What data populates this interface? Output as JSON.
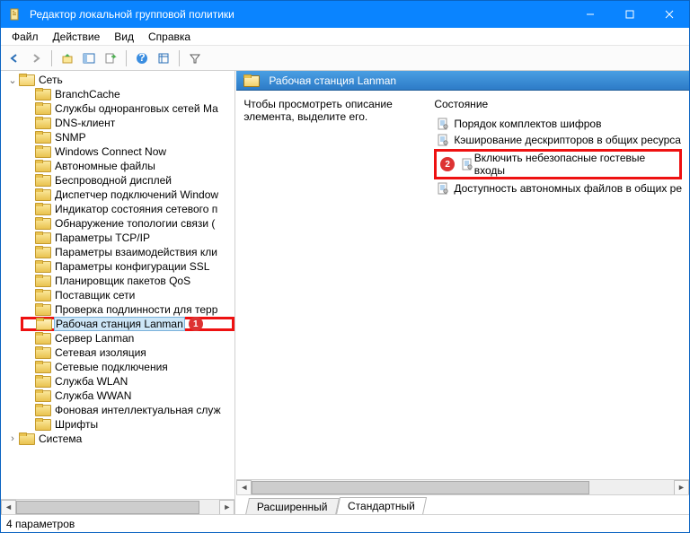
{
  "window": {
    "title": "Редактор локальной групповой политики"
  },
  "menu": {
    "file": "Файл",
    "action": "Действие",
    "view": "Вид",
    "help": "Справка"
  },
  "tree": {
    "root": "Сеть",
    "items": [
      "BranchCache",
      "Службы одноранговых сетей Ма",
      "DNS-клиент",
      "SNMP",
      "Windows Connect Now",
      "Автономные файлы",
      "Беспроводной дисплей",
      "Диспетчер подключений Window",
      "Индикатор состояния сетевого п",
      "Обнаружение топологии связи (",
      "Параметры TCP/IP",
      "Параметры взаимодействия кли",
      "Параметры конфигурации SSL",
      "Планировщик пакетов QoS",
      "Поставщик сети",
      "Проверка подлинности для терр",
      "Рабочая станция Lanman",
      "Сервер Lanman",
      "Сетевая изоляция",
      "Сетевые подключения",
      "Служба WLAN",
      "Служба WWAN",
      "Фоновая интеллектуальная служ",
      "Шрифты"
    ],
    "after": "Система",
    "selectedIndex": 16,
    "markerIndex": 16,
    "marker": "1"
  },
  "right": {
    "header": "Рабочая станция Lanman",
    "hint": "Чтобы просмотреть описание элемента, выделите его.",
    "col": "Состояние",
    "items": [
      "Порядок комплектов шифров",
      "Кэширование дескрипторов в общих ресурса",
      "Включить небезопасные гостевые входы",
      "Доступность автономных файлов в общих ре"
    ],
    "highlightIndex": 2,
    "highlightMarker": "2",
    "tabs": {
      "ext": "Расширенный",
      "std": "Стандартный"
    }
  },
  "status": {
    "text": "4 параметров"
  }
}
